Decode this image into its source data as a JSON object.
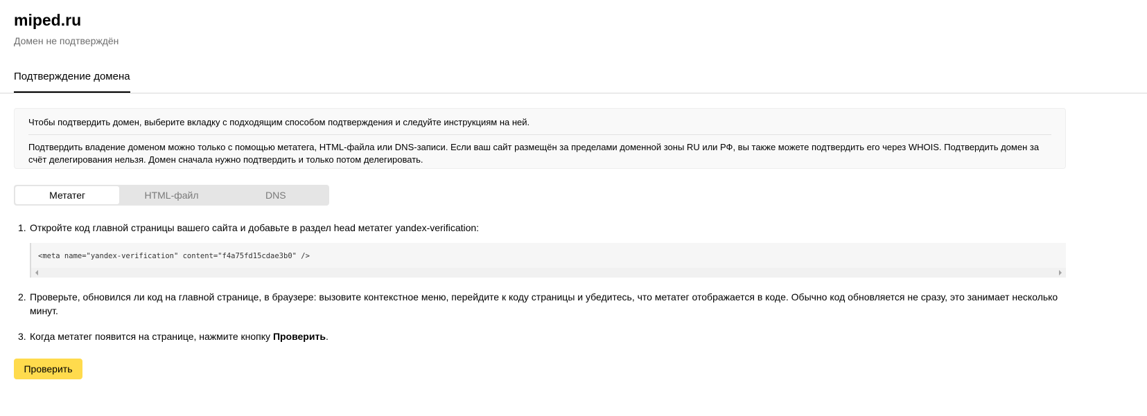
{
  "header": {
    "domain": "miped.ru",
    "status": "Домен не подтверждён"
  },
  "tabs": [
    {
      "label": "Подтверждение домена",
      "active": true
    }
  ],
  "info": {
    "line1": "Чтобы подтвердить домен, выберите вкладку с подходящим способом подтверждения и следуйте инструкциям на ней.",
    "line2": "Подтвердить владение доменом можно только с помощью метатега, HTML-файла или DNS-записи. Если ваш сайт размещён за пределами доменной зоны RU или РФ, вы также можете подтвердить его через WHOIS. Подтвердить домен за счёт делегирования нельзя. Домен сначала нужно подтвердить и только потом делегировать."
  },
  "methods": {
    "selected": "Метатег",
    "options": [
      "Метатег",
      "HTML-файл",
      "DNS"
    ]
  },
  "steps": {
    "s1_num": "1.",
    "s1_text": "Откройте код главной страницы вашего сайта и добавьте в раздел head метатег yandex-verification:",
    "code": "<meta name=\"yandex-verification\" content=\"f4a75fd15cdae3b0\" />",
    "s2_num": "2.",
    "s2_text": "Проверьте, обновился ли код на главной странице, в браузере: вызовите контекстное меню, перейдите к коду страницы и убедитесь, что метатег отображается в коде. Обычно код обновляется не сразу, это занимает несколько минут.",
    "s3_num": "3.",
    "s3_text_before": "Когда метатег появится на странице, нажмите кнопку ",
    "s3_text_bold": "Проверить",
    "s3_text_after": "."
  },
  "button": {
    "check_label": "Проверить",
    "color": "#ffdb4d"
  }
}
